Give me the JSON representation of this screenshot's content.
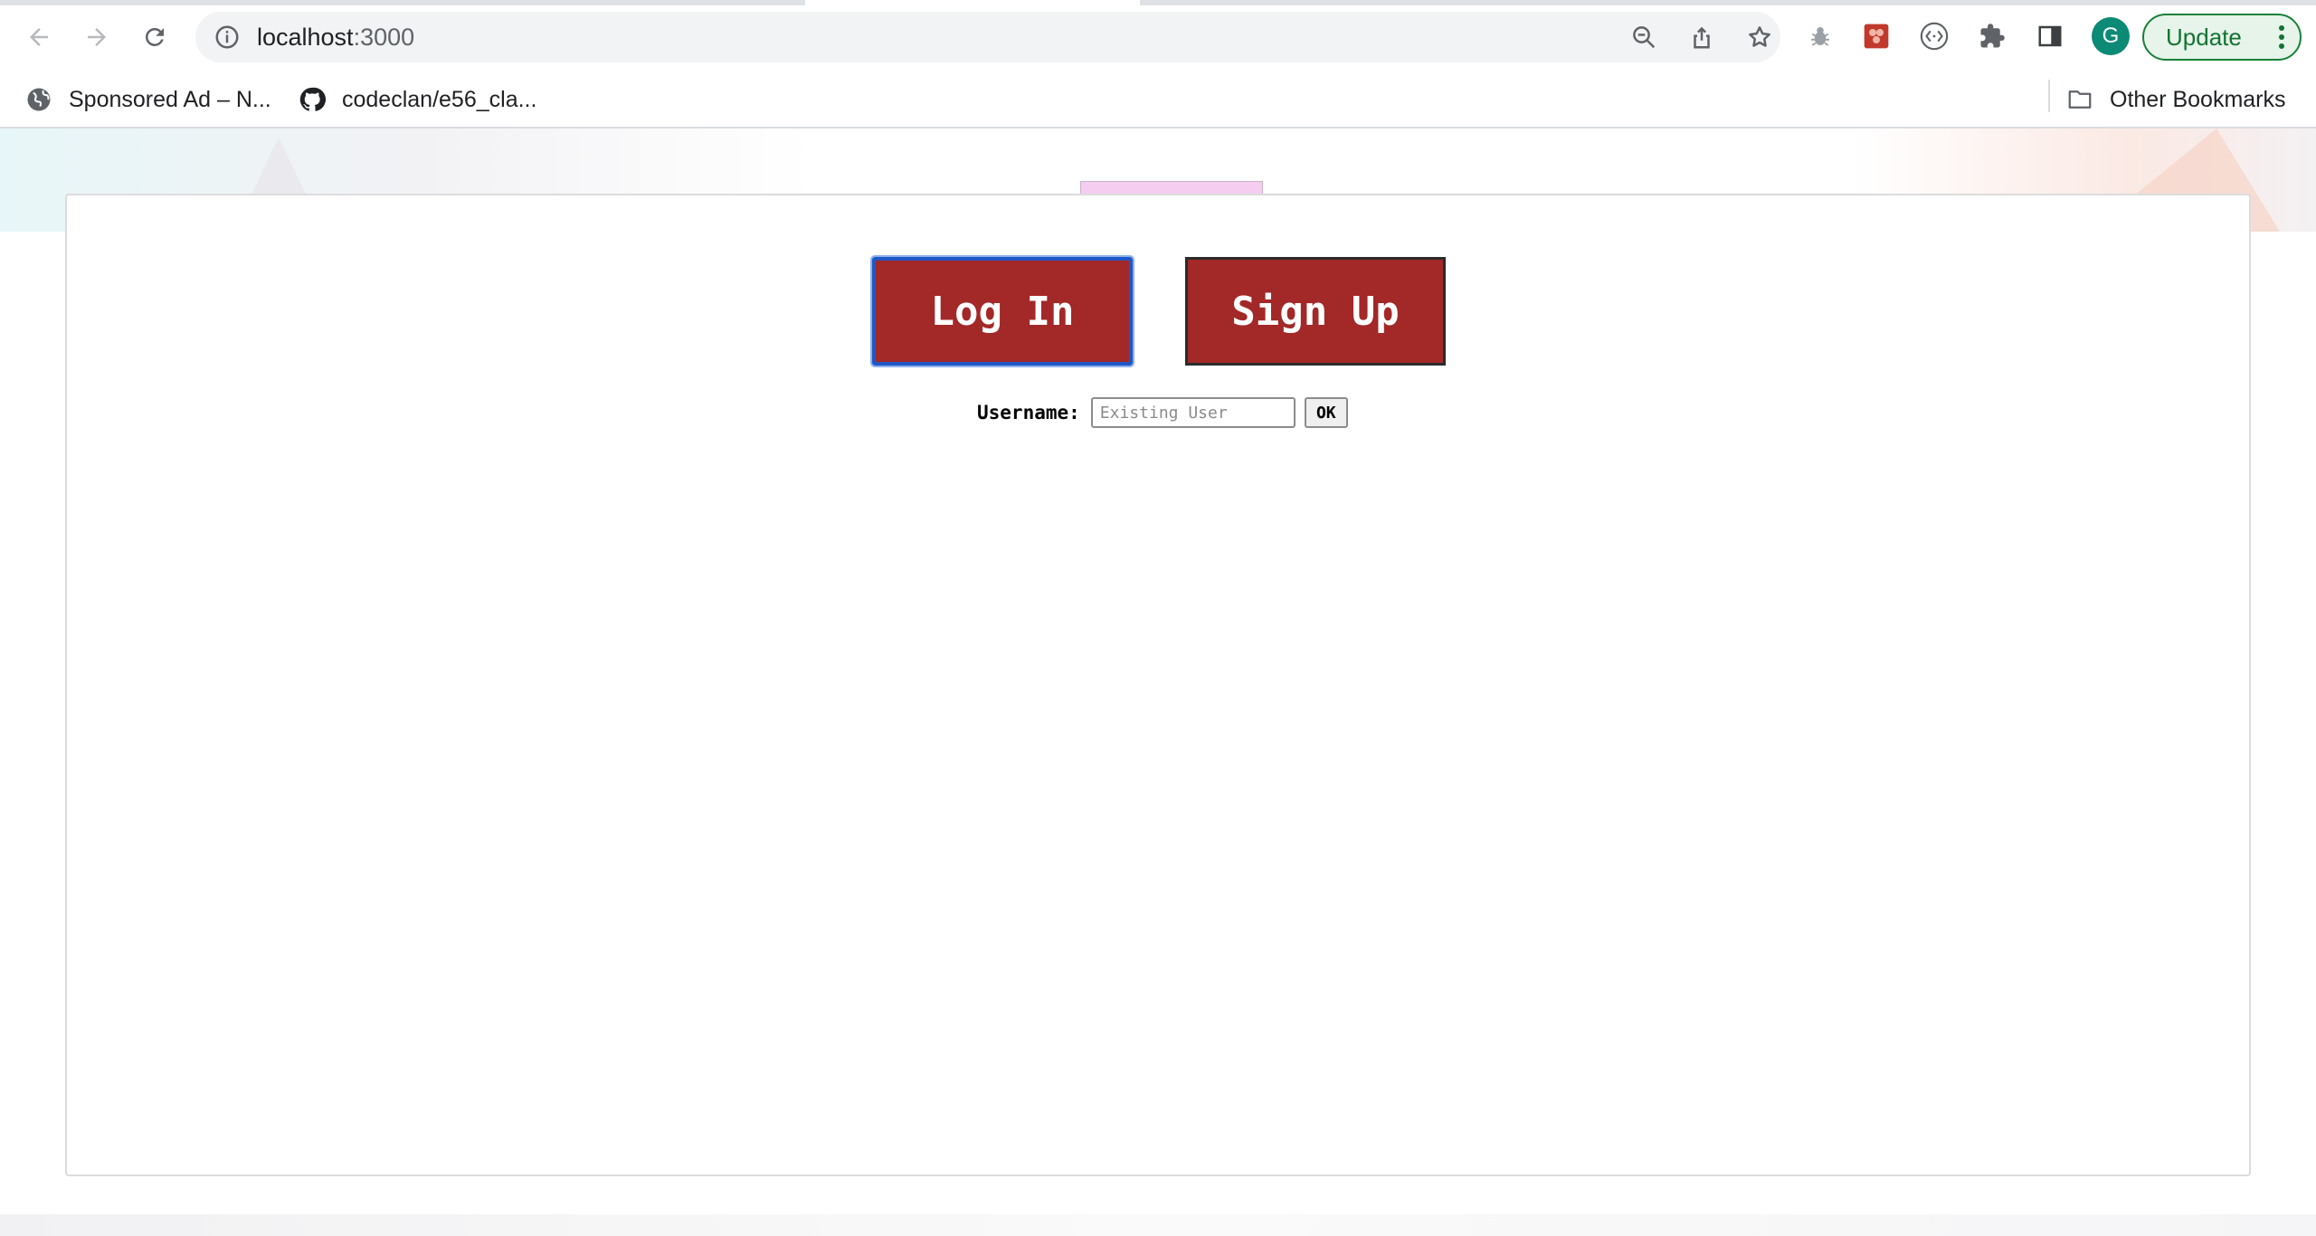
{
  "browser": {
    "url_host": "localhost",
    "url_port": ":3000",
    "update_label": "Update",
    "profile_initial": "G",
    "bookmarks": [
      {
        "label": "Sponsored Ad – N...",
        "icon": "globe-icon"
      },
      {
        "label": "codeclan/e56_cla...",
        "icon": "github-icon"
      }
    ],
    "other_bookmarks_label": "Other Bookmarks"
  },
  "page": {
    "login_button": "Log In",
    "signup_button": "Sign Up",
    "username_label": "Username:",
    "username_placeholder": "Existing User",
    "username_value": "",
    "ok_button": "OK"
  },
  "colors": {
    "button_red": "#a32828",
    "focus_blue": "#1f57c7",
    "update_green": "#188038"
  }
}
